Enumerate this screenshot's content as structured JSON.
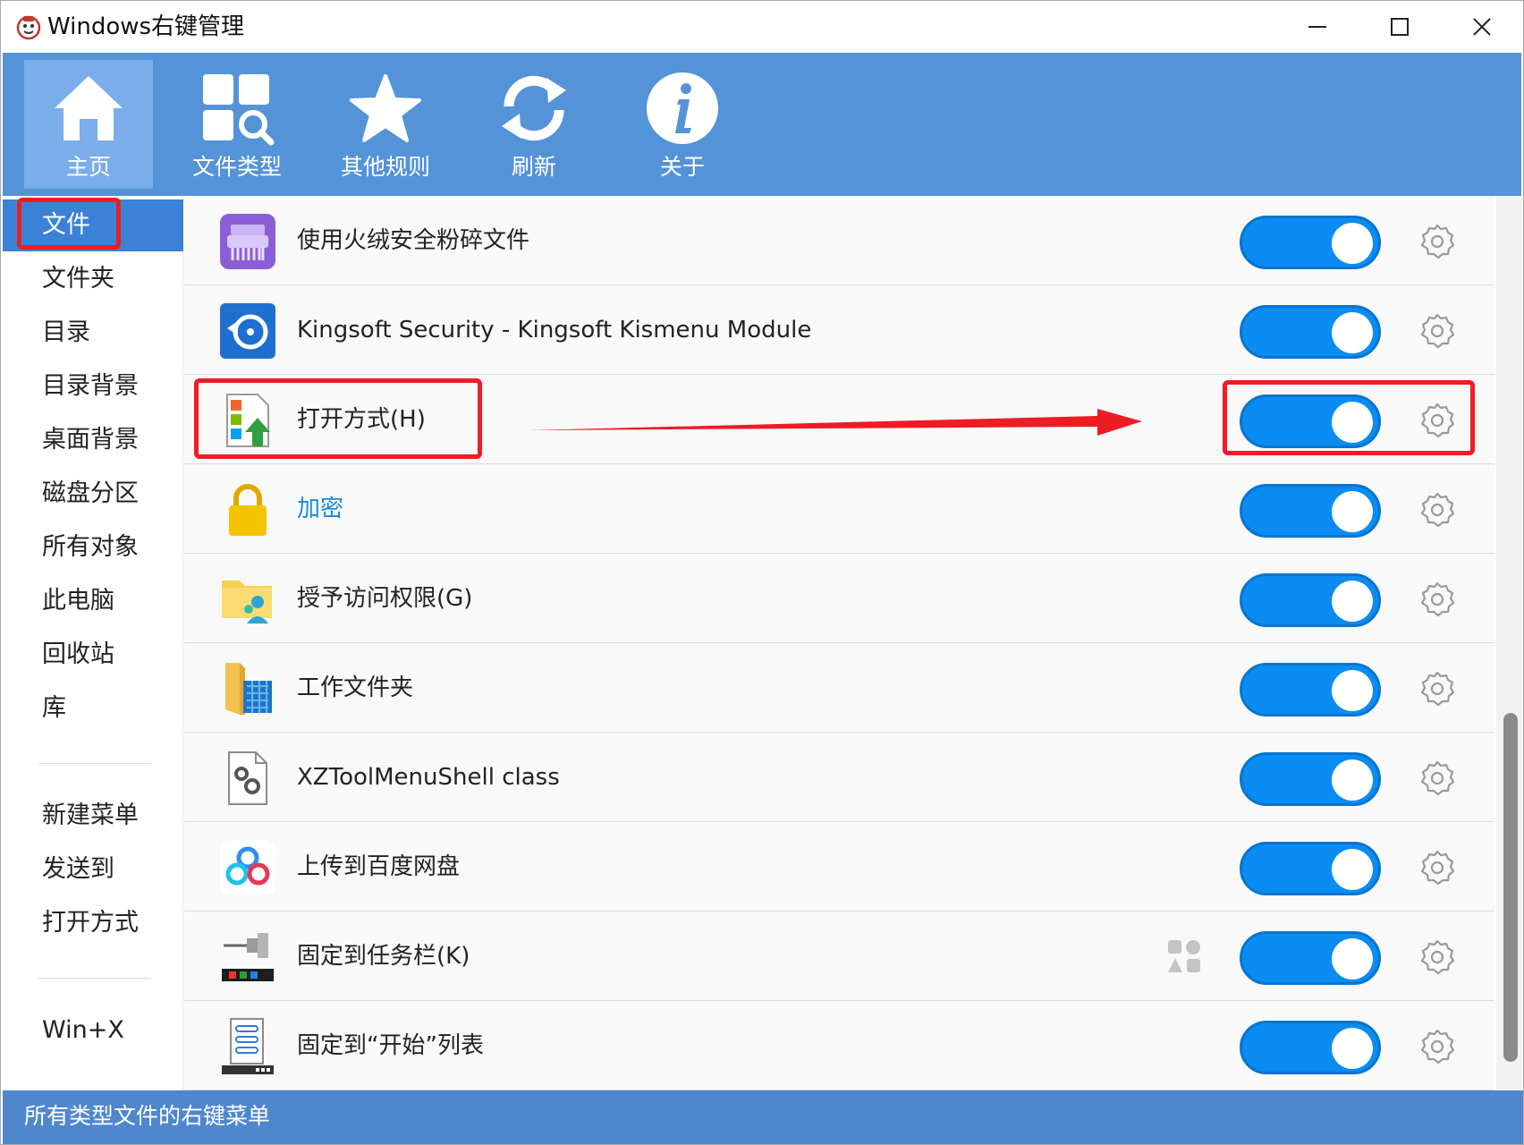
{
  "window": {
    "title": "Windows右键管理",
    "minimize_icon": "minimize-icon",
    "maximize_icon": "maximize-icon",
    "close_icon": "close-icon"
  },
  "toolbar": {
    "items": [
      {
        "label": "主页",
        "icon": "home-icon",
        "active": true
      },
      {
        "label": "文件类型",
        "icon": "file-type-search-icon"
      },
      {
        "label": "其他规则",
        "icon": "star-icon"
      },
      {
        "label": "刷新",
        "icon": "refresh-icon"
      },
      {
        "label": "关于",
        "icon": "info-icon"
      }
    ]
  },
  "sidebar": {
    "items": [
      {
        "label": "文件",
        "active": true
      },
      {
        "label": "文件夹"
      },
      {
        "label": "目录"
      },
      {
        "label": "目录背景"
      },
      {
        "label": "桌面背景"
      },
      {
        "label": "磁盘分区"
      },
      {
        "label": "所有对象"
      },
      {
        "label": "此电脑"
      },
      {
        "label": "回收站"
      },
      {
        "label": "库"
      },
      {
        "label": "新建菜单"
      },
      {
        "label": "发送到"
      },
      {
        "label": "打开方式"
      },
      {
        "label": "Win+X"
      }
    ]
  },
  "menu_items": [
    {
      "label": "使用火绒安全粉碎文件",
      "icon": "shredder-icon",
      "enabled": true
    },
    {
      "label": "Kingsoft Security - Kingsoft Kismenu Module",
      "icon": "kingsoft-icon",
      "enabled": true
    },
    {
      "label": "打开方式(H)",
      "icon": "open-with-icon",
      "enabled": true
    },
    {
      "label": "加密",
      "icon": "lock-icon",
      "enabled": true
    },
    {
      "label": "授予访问权限(G)",
      "icon": "share-folder-icon",
      "enabled": true
    },
    {
      "label": "工作文件夹",
      "icon": "work-folder-icon",
      "enabled": true
    },
    {
      "label": "XZToolMenuShell class",
      "icon": "settings-file-icon",
      "enabled": true
    },
    {
      "label": "上传到百度网盘",
      "icon": "baidu-netdisk-icon",
      "enabled": true
    },
    {
      "label": "固定到任务栏(K)",
      "icon": "pin-taskbar-icon",
      "enabled": true
    },
    {
      "label": "固定到“开始”列表",
      "icon": "pin-start-icon",
      "enabled": true
    }
  ],
  "status": {
    "text": "所有类型文件的右键菜单"
  },
  "colors": {
    "toolbar": "#5593d8",
    "toggle_on": "#0a8cf2",
    "annotation_red": "#ee1c25",
    "link": "#1a8ad8"
  }
}
